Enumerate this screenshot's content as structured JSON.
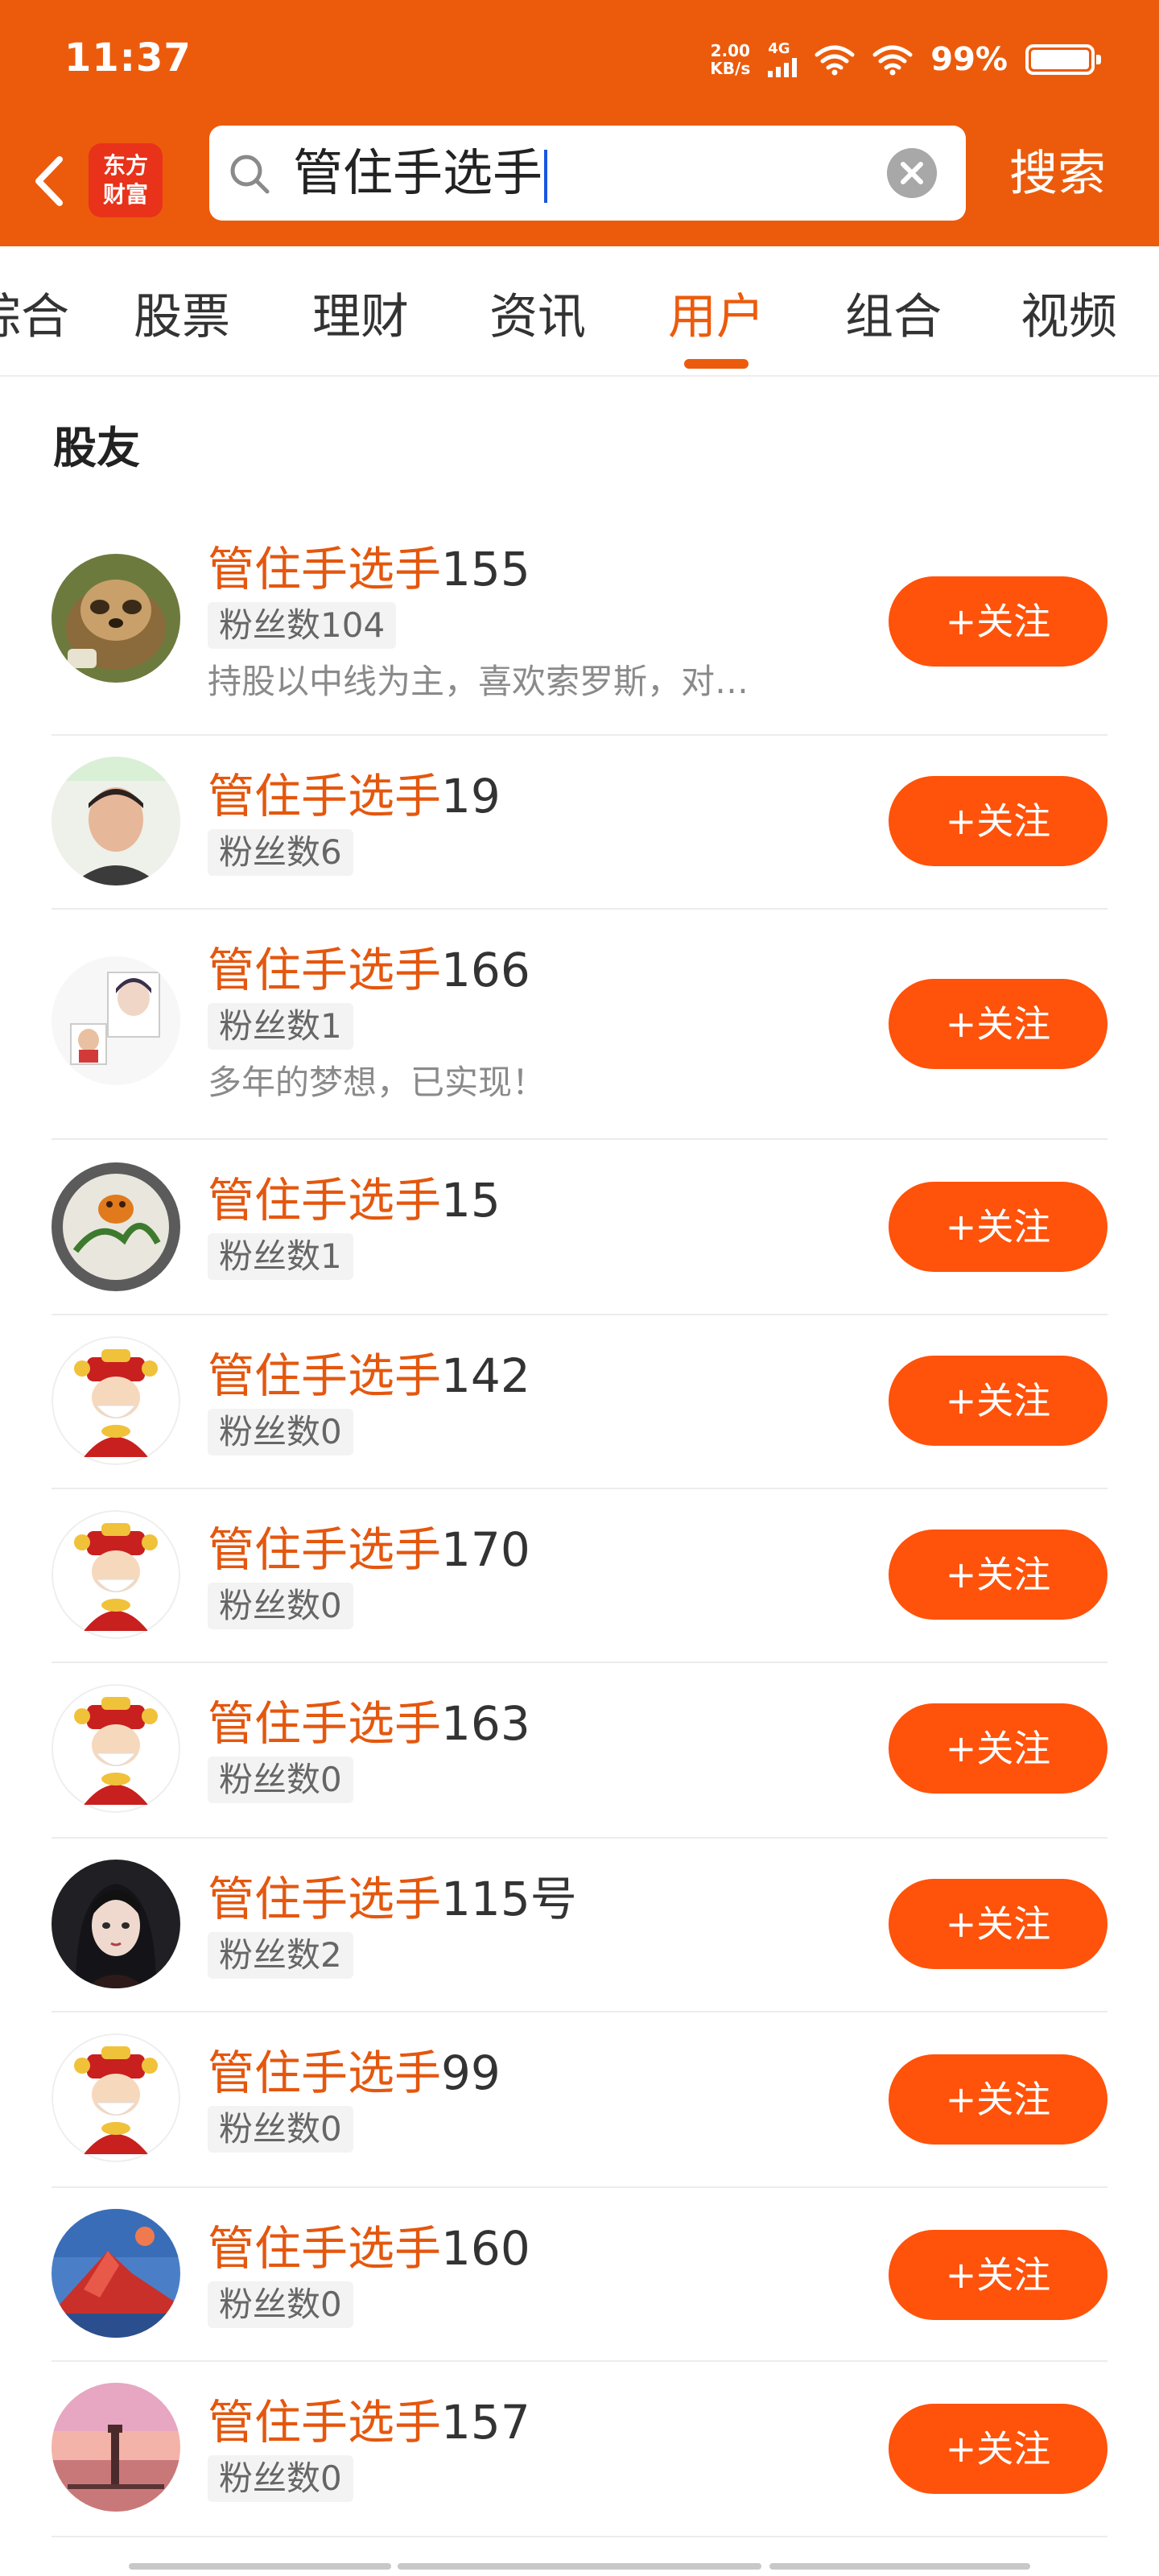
{
  "status_bar": {
    "time": "11:37",
    "net_speed_value": "2.00",
    "net_speed_unit": "KB/s",
    "signal_label": "4G",
    "battery_percent": "99%"
  },
  "nav": {
    "logo_line1": "东方",
    "logo_line2": "财富",
    "search_query": "管住手选手",
    "search_button": "搜索"
  },
  "tabs": [
    {
      "label": "综合"
    },
    {
      "label": "股票"
    },
    {
      "label": "理财"
    },
    {
      "label": "资讯"
    },
    {
      "label": "用户",
      "active": true
    },
    {
      "label": "组合"
    },
    {
      "label": "视频"
    }
  ],
  "section_title": "股友",
  "users": [
    {
      "name_highlight": "管住手选手",
      "name_rest": "155",
      "fans": "粉丝数104",
      "bio": "持股以中线为主，喜欢索罗斯，对…",
      "follow": "+关注",
      "avatar": "sloth"
    },
    {
      "name_highlight": "管住手选手",
      "name_rest": "19",
      "fans": "粉丝数6",
      "bio": "",
      "follow": "+关注",
      "avatar": "person"
    },
    {
      "name_highlight": "管住手选手",
      "name_rest": "166",
      "fans": "粉丝数1",
      "bio": "多年的梦想，已实现！",
      "follow": "+关注",
      "avatar": "sketch"
    },
    {
      "name_highlight": "管住手选手",
      "name_rest": "15",
      "fans": "粉丝数1",
      "bio": "",
      "follow": "+关注",
      "avatar": "plate"
    },
    {
      "name_highlight": "管住手选手",
      "name_rest": "142",
      "fans": "粉丝数0",
      "bio": "",
      "follow": "+关注",
      "avatar": "fortune-god"
    },
    {
      "name_highlight": "管住手选手",
      "name_rest": "170",
      "fans": "粉丝数0",
      "bio": "",
      "follow": "+关注",
      "avatar": "fortune-god"
    },
    {
      "name_highlight": "管住手选手",
      "name_rest": "163",
      "fans": "粉丝数0",
      "bio": "",
      "follow": "+关注",
      "avatar": "fortune-god"
    },
    {
      "name_highlight": "管住手选手",
      "name_rest": "115号",
      "fans": "粉丝数2",
      "bio": "",
      "follow": "+关注",
      "avatar": "anime-girl"
    },
    {
      "name_highlight": "管住手选手",
      "name_rest": "99",
      "fans": "粉丝数0",
      "bio": "",
      "follow": "+关注",
      "avatar": "fortune-god"
    },
    {
      "name_highlight": "管住手选手",
      "name_rest": "160",
      "fans": "粉丝数0",
      "bio": "",
      "follow": "+关注",
      "avatar": "mountain"
    },
    {
      "name_highlight": "管住手选手",
      "name_rest": "157",
      "fans": "粉丝数0",
      "bio": "",
      "follow": "+关注",
      "avatar": "lighthouse"
    }
  ],
  "colors": {
    "brand": "#ec5b0c",
    "follow_button": "#ff520a",
    "highlight": "#e4570e"
  }
}
